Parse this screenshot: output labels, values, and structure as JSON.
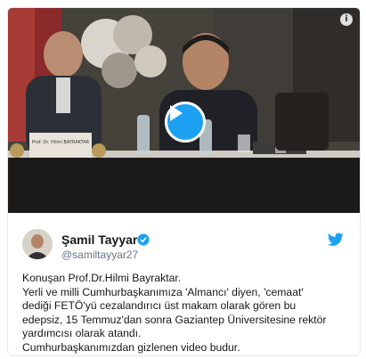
{
  "author": {
    "name": "Şamil Tayyar",
    "handle": "@samiltayyar27",
    "verified_icon": "verified-badge-icon",
    "avatar_icon": "avatar"
  },
  "media": {
    "play_icon": "play-icon",
    "info_icon": "info-icon",
    "info_label": "i",
    "nameplate_text": "Prof. Dr. Hilmi BAYRAKTAR"
  },
  "tweet": {
    "lines": [
      "Konuşan Prof.Dr.Hilmi Bayraktar.",
      "Yerli ve milli Cumhurbaşkanımıza 'Almancı' diyen, 'cemaat'",
      "dediği FETÖ'yü cezalandırıcı üst makam olarak gören bu",
      "edepsiz, 15 Temmuz'dan sonra Gaziantep Üniversitesine rektör",
      "yardımcısı olarak atandı.",
      "Cumhurbaşkanımızdan gizlenen video budur."
    ]
  },
  "colors": {
    "accent": "#1da1f2",
    "text": "#14171a",
    "muted": "#657786"
  }
}
